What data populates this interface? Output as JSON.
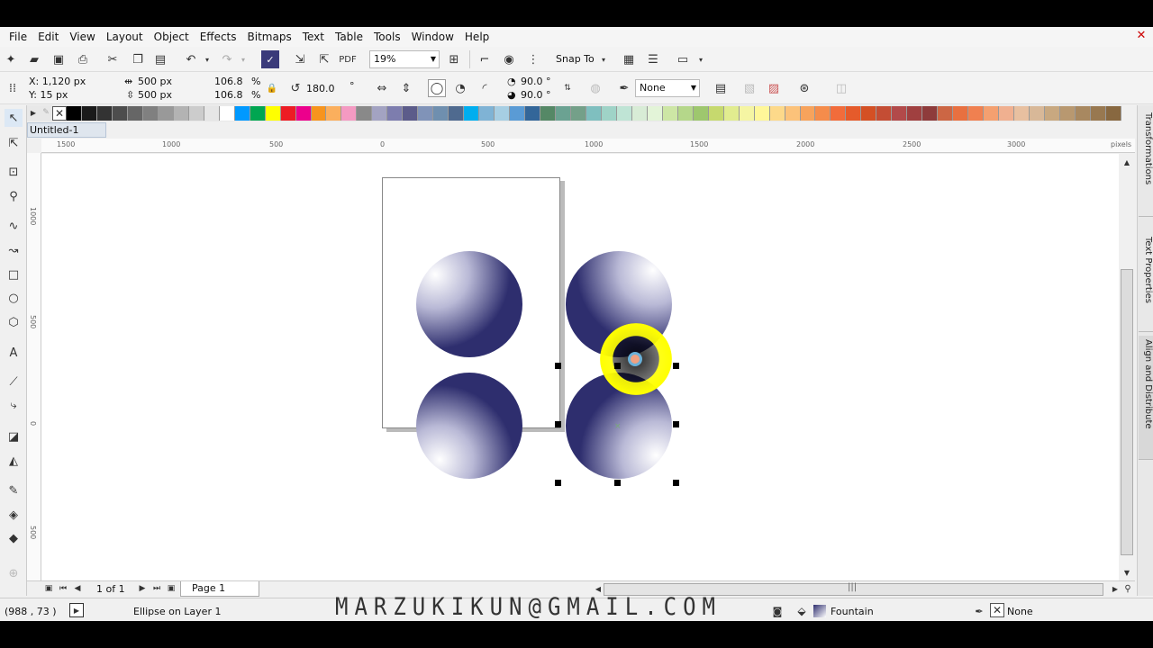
{
  "menu": [
    "File",
    "Edit",
    "View",
    "Layout",
    "Object",
    "Effects",
    "Bitmaps",
    "Text",
    "Table",
    "Tools",
    "Window",
    "Help"
  ],
  "toolbar": {
    "zoom": "19%",
    "snap_to": "Snap To"
  },
  "property_bar": {
    "x": "X: 1,120 px",
    "y": "Y: 15 px",
    "width": "500 px",
    "height": "500 px",
    "scale_w": "106.8",
    "scale_h": "106.8",
    "pct1": "%",
    "pct2": "%",
    "rotation": "180.0",
    "deg": "°",
    "start_angle": "90.0 °",
    "end_angle": "90.0 °",
    "outline": "None"
  },
  "document_tab": "Untitled-1",
  "ruler": {
    "h_labels": [
      "1500",
      "1000",
      "500",
      "0",
      "500",
      "1000",
      "1500",
      "2000",
      "2500",
      "3000"
    ],
    "unit": "pixels",
    "v_labels": [
      "1000",
      "500",
      "0",
      "500"
    ]
  },
  "docker_tabs": [
    "Transformations",
    "Text Properties",
    "Align and Distribute"
  ],
  "page_nav": {
    "count": "1 of 1",
    "page_name": "Page 1"
  },
  "status": {
    "coords": "(988 , 73   )",
    "object_info": "Ellipse on Layer 1",
    "fill": "Fountain",
    "outline": "None"
  },
  "watermark": "MARZUKIKUN@GMAIL.COM",
  "colors": {
    "ball_dark": "#2e2e6e",
    "highlight": "#ffff00"
  },
  "palette": [
    "#000000",
    "#1a1a1a",
    "#333333",
    "#4d4d4d",
    "#666666",
    "#808080",
    "#999999",
    "#b3b3b3",
    "#cccccc",
    "#e6e6e6",
    "#ffffff",
    "#0099ff",
    "#00a651",
    "#ffff00",
    "#ed1c24",
    "#ec008c",
    "#f7941d",
    "#fbaf5d",
    "#f49ac2",
    "#898989",
    "#a3a3c2",
    "#7d7dae",
    "#5c5c8a",
    "#8093b8",
    "#6f8faf",
    "#4f6a8f",
    "#00aeef",
    "#7fb3d5",
    "#a6cee3",
    "#5a9bd5",
    "#336699",
    "#558866",
    "#6ba292",
    "#74a089",
    "#7fbfbf",
    "#9fd3c7",
    "#bfe4d5",
    "#d8ecd6",
    "#e3f4d8",
    "#cde6a5",
    "#b5d78a",
    "#9ec76e",
    "#c6d96e",
    "#e1ec8f",
    "#f5f5a3",
    "#fff799",
    "#fdd98a",
    "#fcc27a",
    "#f7a35c",
    "#f58c4b",
    "#f26c3b",
    "#e55b2b",
    "#d45024",
    "#c44d34",
    "#b24a4a",
    "#a04040",
    "#8e3b3b",
    "#cc6644",
    "#e87040",
    "#f08050",
    "#f4a070",
    "#f0b090",
    "#e8c0a0",
    "#d8b898",
    "#c8a880",
    "#b89870",
    "#a88860",
    "#987850",
    "#886840"
  ]
}
